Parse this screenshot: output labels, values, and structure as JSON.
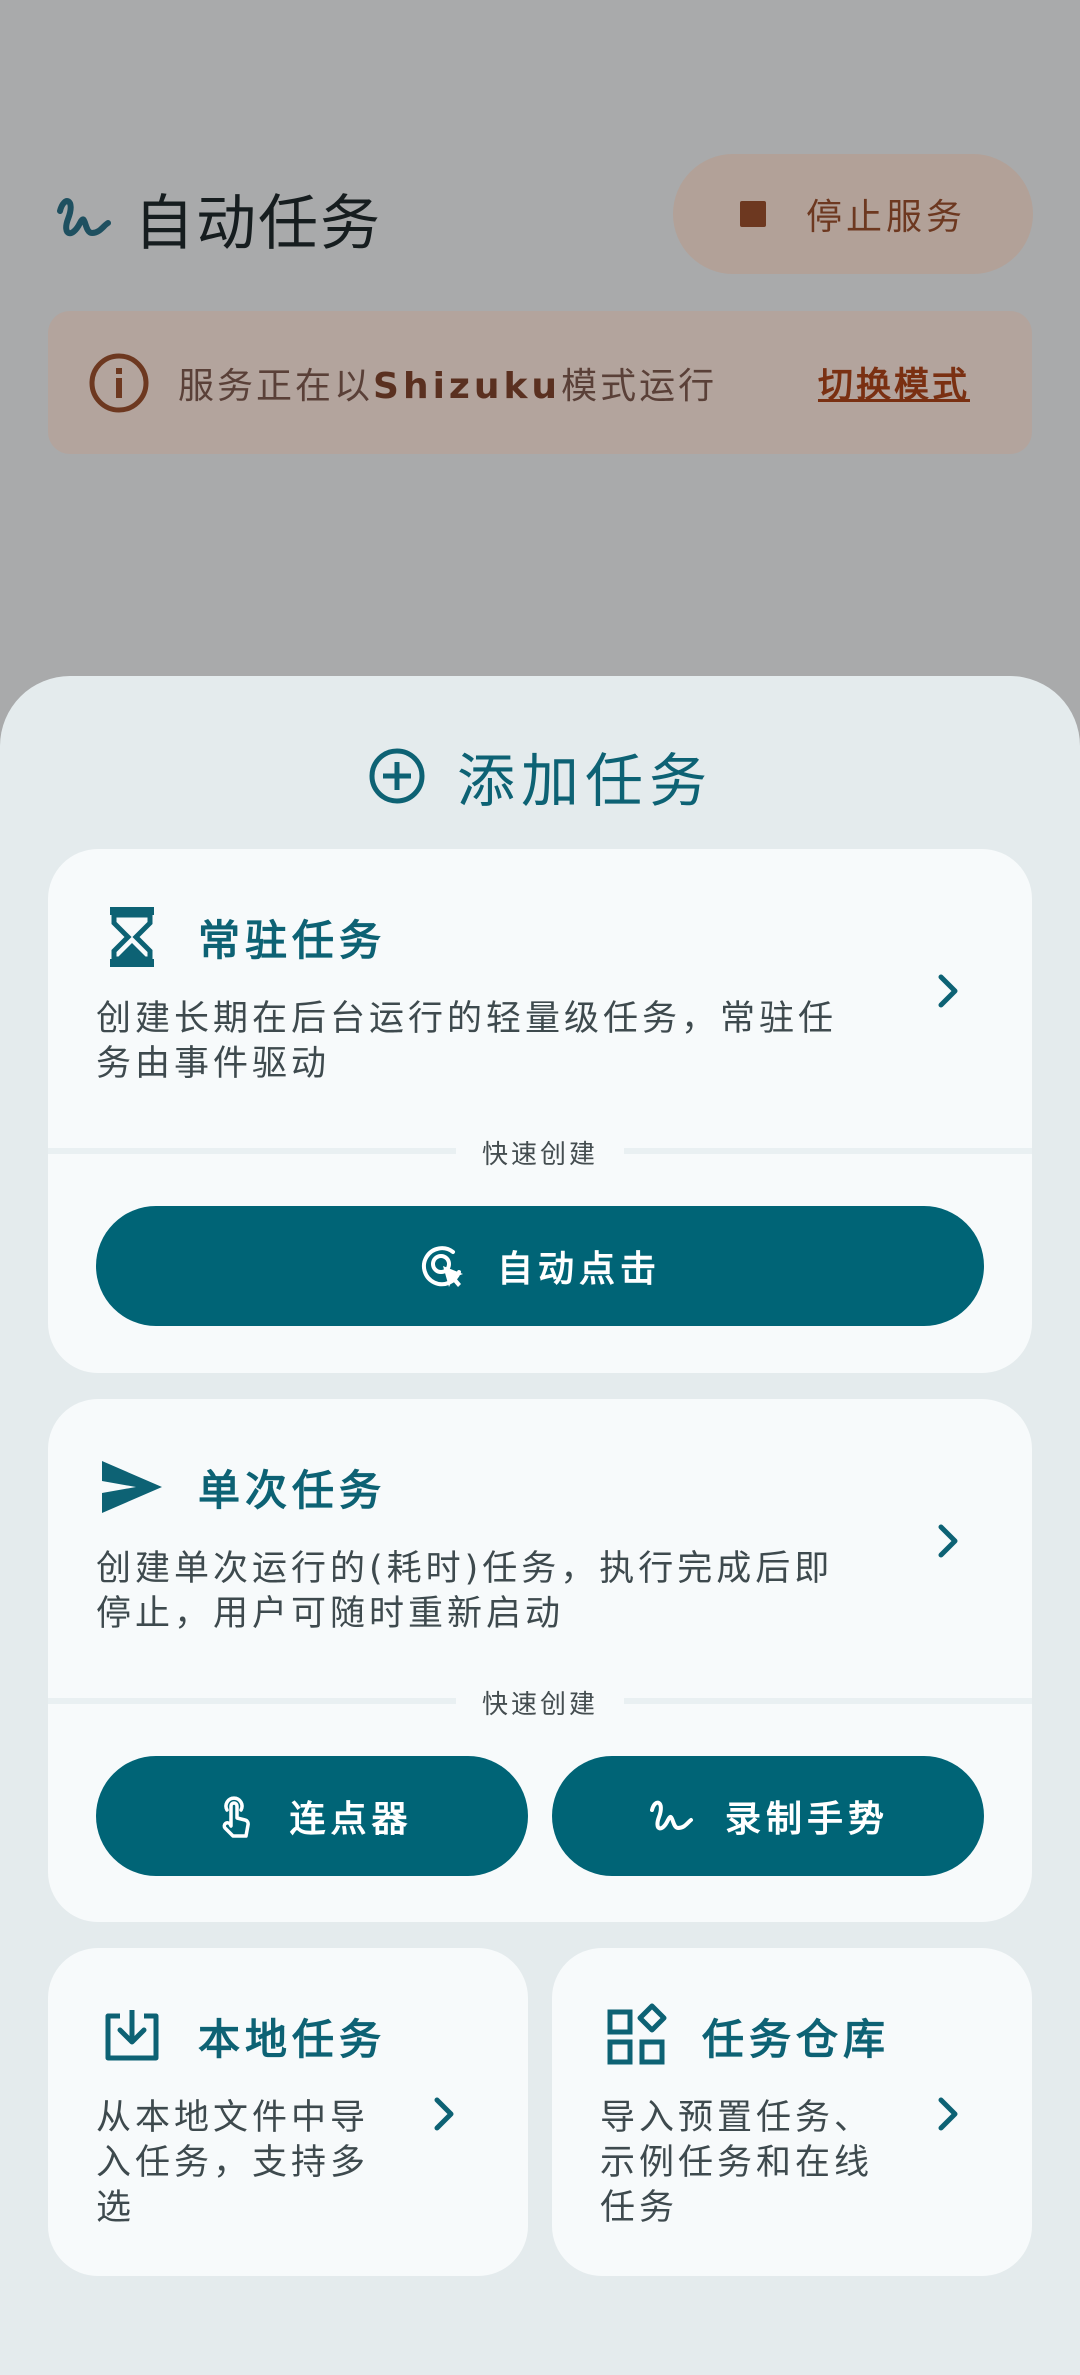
{
  "app": {
    "title": "自动任务",
    "stop_button": "停止服务"
  },
  "notice": {
    "message_prefix": "服务正在以",
    "message_mode": "Shizuku",
    "message_suffix": "模式运行",
    "switch_label": "切换模式"
  },
  "sheet": {
    "title": "添加任务",
    "resident": {
      "title": "常驻任务",
      "desc_line1": "创建长期在后台运行的轻量级任务，常驻任",
      "desc_line2": "务由事件驱动",
      "quick_label": "快速创建",
      "quick_button": "自动点击"
    },
    "oneshot": {
      "title": "单次任务",
      "desc_line1": "创建单次运行的(耗时)任务，执行完成后即",
      "desc_line2": "停止，用户可随时重新启动",
      "quick_label": "快速创建",
      "button_clicker": "连点器",
      "button_gesture": "录制手势"
    },
    "local": {
      "title": "本地任务",
      "desc_line1": "从本地文件中导",
      "desc_line2": "入任务，支持多",
      "desc_line3": "选"
    },
    "repo": {
      "title": "任务仓库",
      "desc_line1": "导入预置任务、",
      "desc_line2": "示例任务和在线",
      "desc_line3": "任务"
    }
  },
  "icons": {
    "app_logo": "squiggle-icon",
    "stop": "stop-square-icon",
    "info": "info-icon",
    "add": "add-circle-icon",
    "resident": "hourglass-icon",
    "oneshot": "send-icon",
    "auto_click": "touch-target-icon",
    "clicker": "tap-finger-icon",
    "gesture": "squiggle-icon",
    "local": "download-icon",
    "repo": "widgets-icon",
    "chevron": "chevron-right-icon"
  },
  "colors": {
    "accent": "#006476",
    "accent_text": "#0d6274",
    "scrim_bg": "#a9aaab",
    "sheet_bg": "#e4ebed",
    "card_bg": "#f7fafb",
    "notice_bg": "#b3a49d",
    "notice_link": "#7a3012"
  }
}
